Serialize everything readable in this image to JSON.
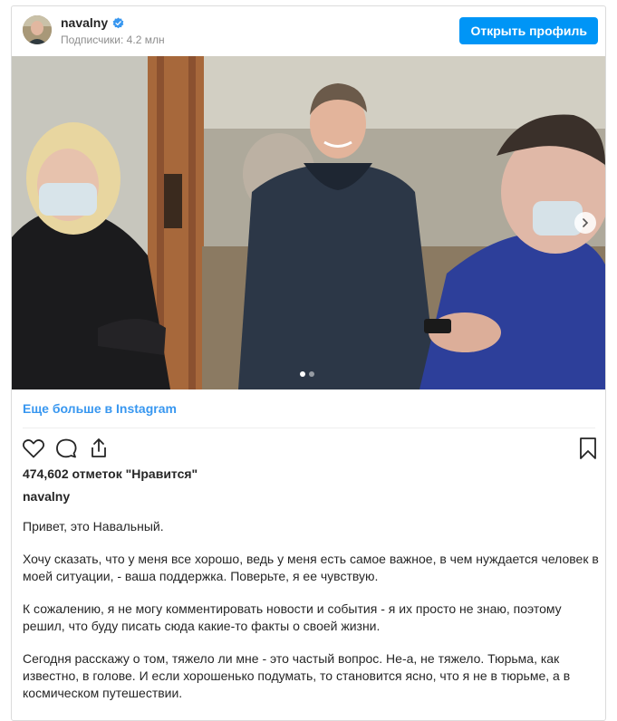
{
  "header": {
    "username": "navalny",
    "followers": "Подписчики: 4.2 млн",
    "open_profile": "Открыть профиль"
  },
  "media": {
    "carousel_dots": 2,
    "active_dot": 0
  },
  "more_link": "Еще больше в Instagram",
  "likes": "474,602 отметок \"Нравится\"",
  "author": "navalny",
  "caption": [
    "Привет, это Навальный.",
    "Хочу сказать, что у меня все хорошо, ведь у меня есть самое важное, в чем нуждается человек в моей ситуации, - ваша поддержка. Поверьте, я ее чувствую.",
    "К сожалению, я не могу комментировать новости и события - я их просто не знаю, поэтому решил, что буду писать сюда какие-то факты о своей жизни.",
    "Сегодня расскажу о том, тяжело ли мне - это частый вопрос. Не-а, не тяжело. Тюрьма, как известно, в голове. И если хорошенько подумать, то становится ясно, что я не в тюрьме, а в космическом путешествии."
  ],
  "colors": {
    "accent": "#0095f6",
    "link": "#3897f0",
    "verified": "#3897f0"
  }
}
